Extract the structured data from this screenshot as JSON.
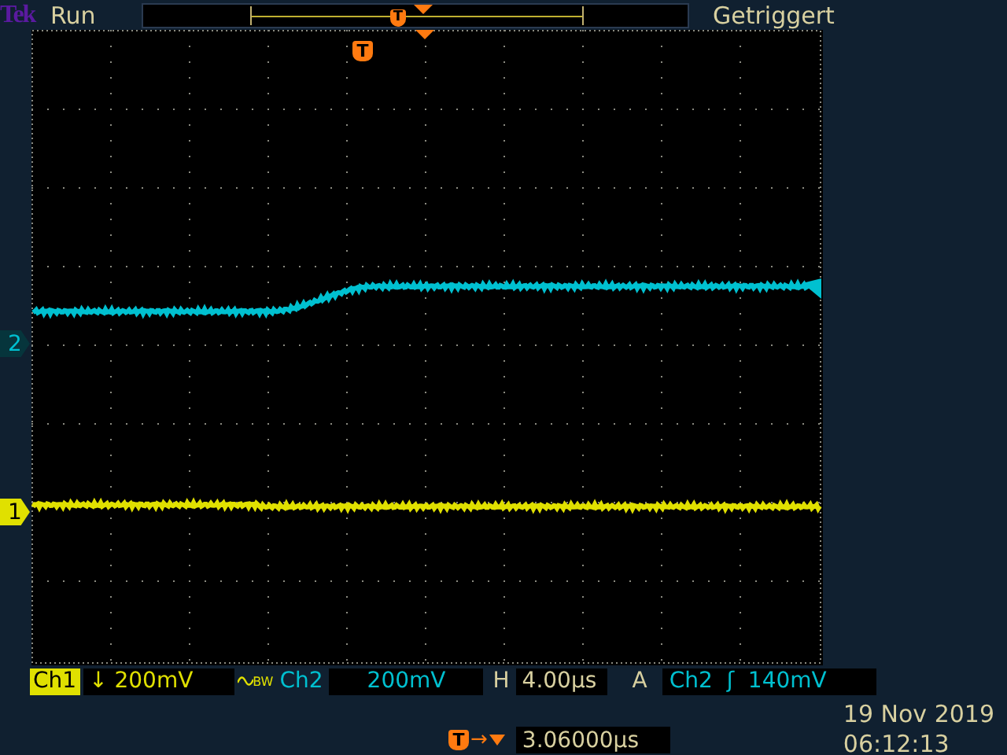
{
  "header": {
    "logo": "Tek",
    "status": "Run",
    "record_trigger_marker": "T",
    "trigger_state": "Getriggert"
  },
  "screen": {
    "trigger_marker": "T"
  },
  "channels": [
    {
      "marker": "2",
      "color": "#00c0d0"
    },
    {
      "marker": "1",
      "color": "#e0e000"
    }
  ],
  "readouts": {
    "ch1": {
      "label": "Ch1",
      "selected": true,
      "coupling": "↓",
      "scale": "200mV",
      "bw_limit": "BW"
    },
    "ch2": {
      "label": "Ch2",
      "selected": false,
      "scale": "200mV"
    },
    "horizontal": {
      "label": "H",
      "scale": "4.00µs"
    },
    "trigger": {
      "label": "A",
      "source": "Ch2",
      "slope": "ʃ",
      "level": "140mV"
    }
  },
  "footer": {
    "trigger_marker": "T",
    "arrow": "→",
    "position": "3.06000µs",
    "date": "19 Nov 2019",
    "time": "06:12:13"
  }
}
